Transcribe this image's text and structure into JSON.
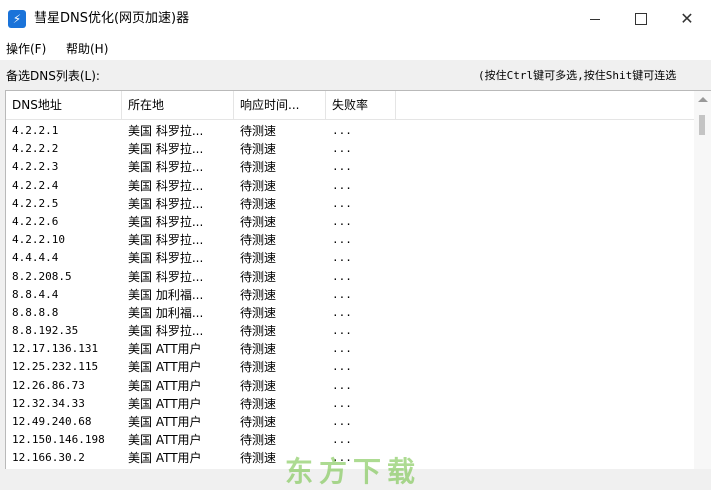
{
  "window": {
    "title": "彗星DNS优化(网页加速)器",
    "app_icon": "⚡",
    "minimize_icon": "minimize-icon",
    "maximize_icon": "maximize-icon",
    "close_icon": "close-icon",
    "close_glyph": "✕"
  },
  "menu": {
    "operate": "操作(F)",
    "help": "帮助(H)"
  },
  "list_label": "备选DNS列表(L):",
  "hint": "(按住Ctrl键可多选,按住Shit键可连选",
  "columns": [
    "DNS地址",
    "所在地",
    "响应时间...",
    "失败率"
  ],
  "rows": [
    {
      "ip": "4.2.2.1",
      "loc": "美国 科罗拉...",
      "resp": "待测速",
      "fail": "..."
    },
    {
      "ip": "4.2.2.2",
      "loc": "美国 科罗拉...",
      "resp": "待测速",
      "fail": "..."
    },
    {
      "ip": "4.2.2.3",
      "loc": "美国 科罗拉...",
      "resp": "待测速",
      "fail": "..."
    },
    {
      "ip": "4.2.2.4",
      "loc": "美国 科罗拉...",
      "resp": "待测速",
      "fail": "..."
    },
    {
      "ip": "4.2.2.5",
      "loc": "美国 科罗拉...",
      "resp": "待测速",
      "fail": "..."
    },
    {
      "ip": "4.2.2.6",
      "loc": "美国 科罗拉...",
      "resp": "待测速",
      "fail": "..."
    },
    {
      "ip": "4.2.2.10",
      "loc": "美国 科罗拉...",
      "resp": "待测速",
      "fail": "..."
    },
    {
      "ip": "4.4.4.4",
      "loc": "美国 科罗拉...",
      "resp": "待测速",
      "fail": "..."
    },
    {
      "ip": "8.2.208.5",
      "loc": "美国 科罗拉...",
      "resp": "待测速",
      "fail": "..."
    },
    {
      "ip": "8.8.4.4",
      "loc": "美国 加利福...",
      "resp": "待测速",
      "fail": "..."
    },
    {
      "ip": "8.8.8.8",
      "loc": "美国 加利福...",
      "resp": "待测速",
      "fail": "..."
    },
    {
      "ip": "8.8.192.35",
      "loc": "美国 科罗拉...",
      "resp": "待测速",
      "fail": "..."
    },
    {
      "ip": "12.17.136.131",
      "loc": "美国 ATT用户",
      "resp": "待测速",
      "fail": "..."
    },
    {
      "ip": "12.25.232.115",
      "loc": "美国 ATT用户",
      "resp": "待测速",
      "fail": "..."
    },
    {
      "ip": "12.26.86.73",
      "loc": "美国 ATT用户",
      "resp": "待测速",
      "fail": "..."
    },
    {
      "ip": "12.32.34.33",
      "loc": "美国 ATT用户",
      "resp": "待测速",
      "fail": "..."
    },
    {
      "ip": "12.49.240.68",
      "loc": "美国 ATT用户",
      "resp": "待测速",
      "fail": "..."
    },
    {
      "ip": "12.150.146.198",
      "loc": "美国 ATT用户",
      "resp": "待测速",
      "fail": "..."
    },
    {
      "ip": "12.166.30.2",
      "loc": "美国 ATT用户",
      "resp": "待测速",
      "fail": "..."
    }
  ],
  "watermark": "东方下载",
  "colors": {
    "accent": "#1a73d9",
    "watermark": "#6bbf3a"
  }
}
